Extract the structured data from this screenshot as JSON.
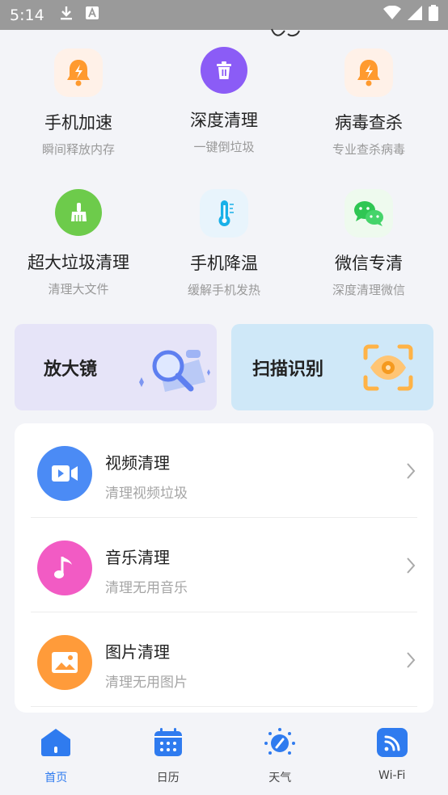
{
  "status_bar": {
    "time": "5:14"
  },
  "features": [
    {
      "title": "手机加速",
      "subtitle": "瞬间释放内存",
      "icon": "bell-bolt-icon"
    },
    {
      "title": "深度清理",
      "subtitle": "一键倒垃圾",
      "icon": "trash-icon"
    },
    {
      "title": "病毒查杀",
      "subtitle": "专业查杀病毒",
      "icon": "bell-bolt-icon"
    },
    {
      "title": "超大垃圾清理",
      "subtitle": "清理大文件",
      "icon": "broom-icon"
    },
    {
      "title": "手机降温",
      "subtitle": "缓解手机发热",
      "icon": "thermometer-icon"
    },
    {
      "title": "微信专清",
      "subtitle": "深度清理微信",
      "icon": "wechat-icon"
    }
  ],
  "tools": {
    "magnifier_label": "放大镜",
    "scan_label": "扫描识别"
  },
  "list": [
    {
      "title": "视频清理",
      "subtitle": "清理视频垃圾",
      "icon": "video-icon",
      "color": "#4b8bf5"
    },
    {
      "title": "音乐清理",
      "subtitle": "清理无用音乐",
      "icon": "music-note-icon",
      "color": "#f25bc4"
    },
    {
      "title": "图片清理",
      "subtitle": "清理无用图片",
      "icon": "image-icon",
      "color": "#ff9b3a"
    }
  ],
  "nav": [
    {
      "label": "首页",
      "icon": "home-icon",
      "active": true
    },
    {
      "label": "日历",
      "icon": "calendar-icon",
      "active": false
    },
    {
      "label": "天气",
      "icon": "weather-sun-icon",
      "active": false
    },
    {
      "label": "Wi-Fi",
      "icon": "wifi-icon",
      "active": false
    }
  ],
  "colors": {
    "accent": "#2f7bef",
    "background": "#f3f4f8"
  }
}
